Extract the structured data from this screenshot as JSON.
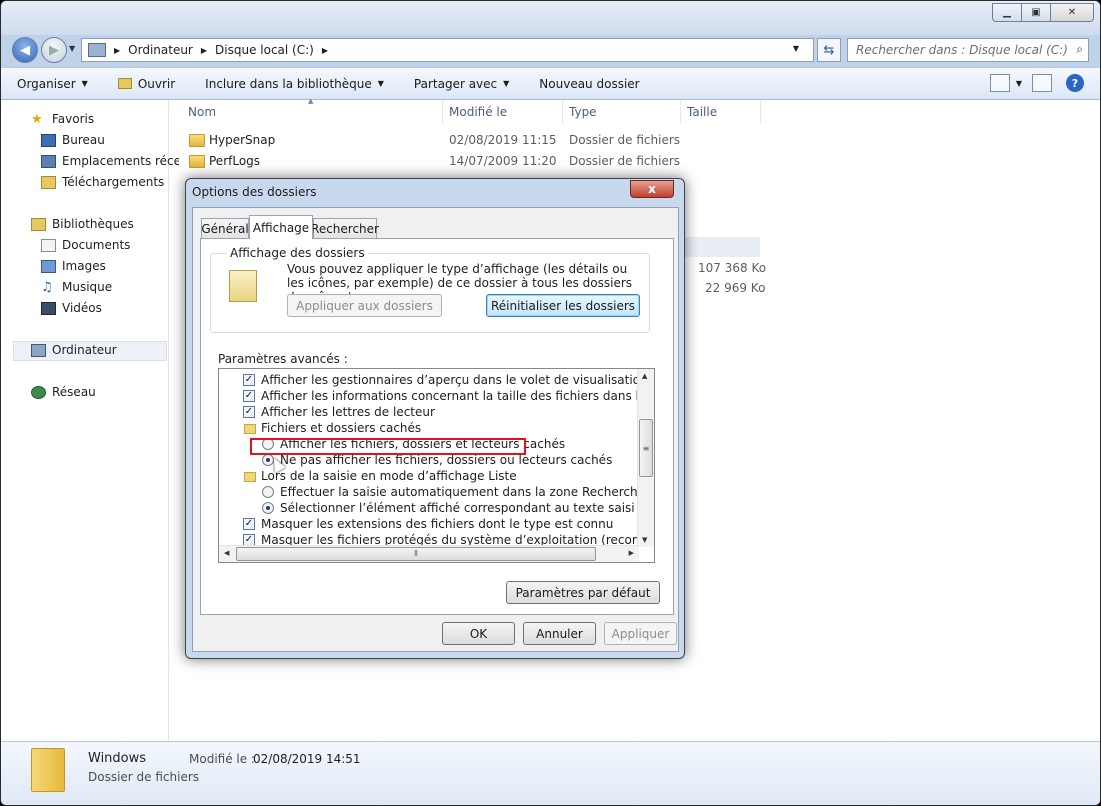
{
  "nav": {
    "breadcrumb": [
      "Ordinateur",
      "Disque local (C:)"
    ],
    "search_placeholder": "Rechercher dans : Disque local (C:)"
  },
  "toolbar": {
    "organize": "Organiser",
    "open": "Ouvrir",
    "include": "Inclure dans la bibliothèque",
    "share": "Partager avec",
    "new_folder": "Nouveau dossier"
  },
  "sidebar": {
    "favorites": "Favoris",
    "desktop": "Bureau",
    "recent": "Emplacements récents",
    "downloads": "Téléchargements",
    "libraries": "Bibliothèques",
    "documents": "Documents",
    "images": "Images",
    "music": "Musique",
    "videos": "Vidéos",
    "computer": "Ordinateur",
    "network": "Réseau"
  },
  "columns": {
    "name": "Nom",
    "modified": "Modifié le",
    "type": "Type",
    "size": "Taille"
  },
  "files": [
    {
      "name": "HyperSnap",
      "modified": "02/08/2019 11:15",
      "type": "Dossier de fichiers"
    },
    {
      "name": "PerfLogs",
      "modified": "14/07/2009 11:20",
      "type": "Dossier de fichiers"
    }
  ],
  "sizes": [
    "107 368 Ko",
    "22 969 Ko"
  ],
  "details": {
    "name": "Windows",
    "type": "Dossier de fichiers",
    "modified_label": "Modifié le :",
    "modified_value": "02/08/2019 14:51"
  },
  "dialog": {
    "title": "Options des dossiers",
    "close": "x",
    "tabs": [
      "Général",
      "Affichage",
      "Rechercher"
    ],
    "group_label": "Affichage des dossiers",
    "group_text": "Vous pouvez appliquer le type d’affichage (les détails ou les icônes, par exemple) de ce dossier à tous les dossiers du même type.",
    "apply_folders": "Appliquer aux dossiers",
    "reset_folders": "Réinitialiser les dossiers",
    "advanced_label": "Paramètres avancés :",
    "advanced": [
      {
        "kind": "check",
        "checked": true,
        "indent": 0,
        "text": "Afficher les gestionnaires d’aperçu dans le volet de visualisation"
      },
      {
        "kind": "check",
        "checked": true,
        "indent": 0,
        "text": "Afficher les informations concernant la taille des fichiers dans les info-bulles du do"
      },
      {
        "kind": "check",
        "checked": true,
        "indent": 0,
        "text": "Afficher les lettres de lecteur"
      },
      {
        "kind": "folder",
        "checked": false,
        "indent": 0,
        "text": "Fichiers et dossiers cachés"
      },
      {
        "kind": "radio",
        "checked": false,
        "indent": 1,
        "text": "Afficher les fichiers, dossiers et lecteurs cachés"
      },
      {
        "kind": "radio",
        "checked": true,
        "indent": 1,
        "text": "Ne pas afficher les fichiers, dossiers ou lecteurs cachés"
      },
      {
        "kind": "folder",
        "checked": false,
        "indent": 0,
        "text": "Lors de la saisie en mode d’affichage Liste"
      },
      {
        "kind": "radio",
        "checked": false,
        "indent": 1,
        "text": "Effectuer la saisie automatiquement dans la zone Rechercher"
      },
      {
        "kind": "radio",
        "checked": true,
        "indent": 1,
        "text": "Sélectionner l’élément affiché correspondant au texte saisi"
      },
      {
        "kind": "check",
        "checked": true,
        "indent": 0,
        "text": "Masquer les extensions des fichiers dont le type est connu"
      },
      {
        "kind": "check",
        "checked": true,
        "indent": 0,
        "text": "Masquer les fichiers protégés du système d’exploitation (recommandé)"
      }
    ],
    "defaults": "Paramètres par défaut",
    "ok": "OK",
    "cancel": "Annuler",
    "apply": "Appliquer"
  }
}
